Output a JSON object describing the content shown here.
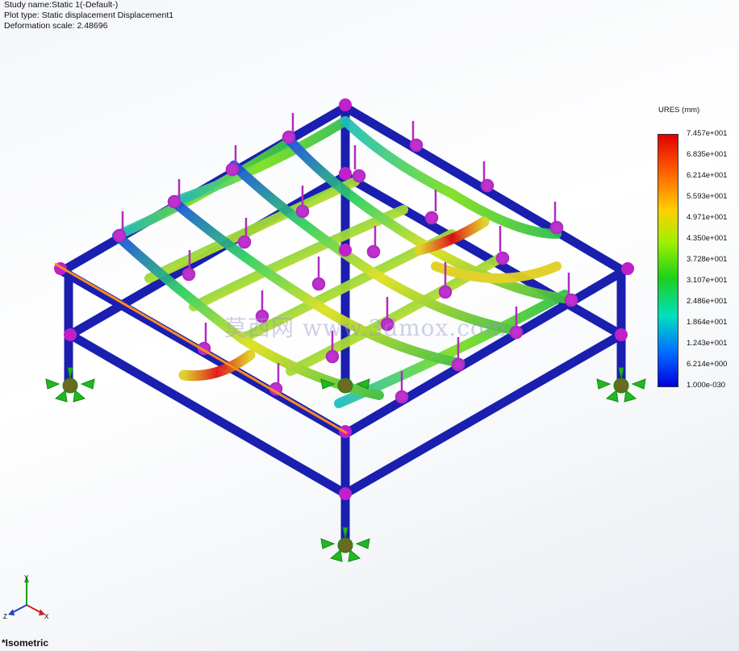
{
  "study": {
    "name_line": "Study name:Static 1(-Default-)",
    "plot_type_line": "Plot type: Static displacement Displacement1",
    "deformation_line": "Deformation scale: 2.48696"
  },
  "legend": {
    "title": "URES (mm)",
    "values": [
      "7.457e+001",
      "6.835e+001",
      "6.214e+001",
      "5.593e+001",
      "4.971e+001",
      "4.350e+001",
      "3.728e+001",
      "3.107e+001",
      "2.486e+001",
      "1.864e+001",
      "1.243e+001",
      "6.214e+000",
      "1.000e-030"
    ]
  },
  "view": {
    "name": "*Isometric"
  },
  "triad": {
    "x": "X",
    "y": "Y",
    "z": "Z"
  },
  "watermark": "莫西网 www.3dmox.com",
  "colors": {
    "frame": "#1a1fb0",
    "load_arrow": "#b02cc0",
    "fixture": "#22b822",
    "probe_line": "#ff8a1f"
  }
}
